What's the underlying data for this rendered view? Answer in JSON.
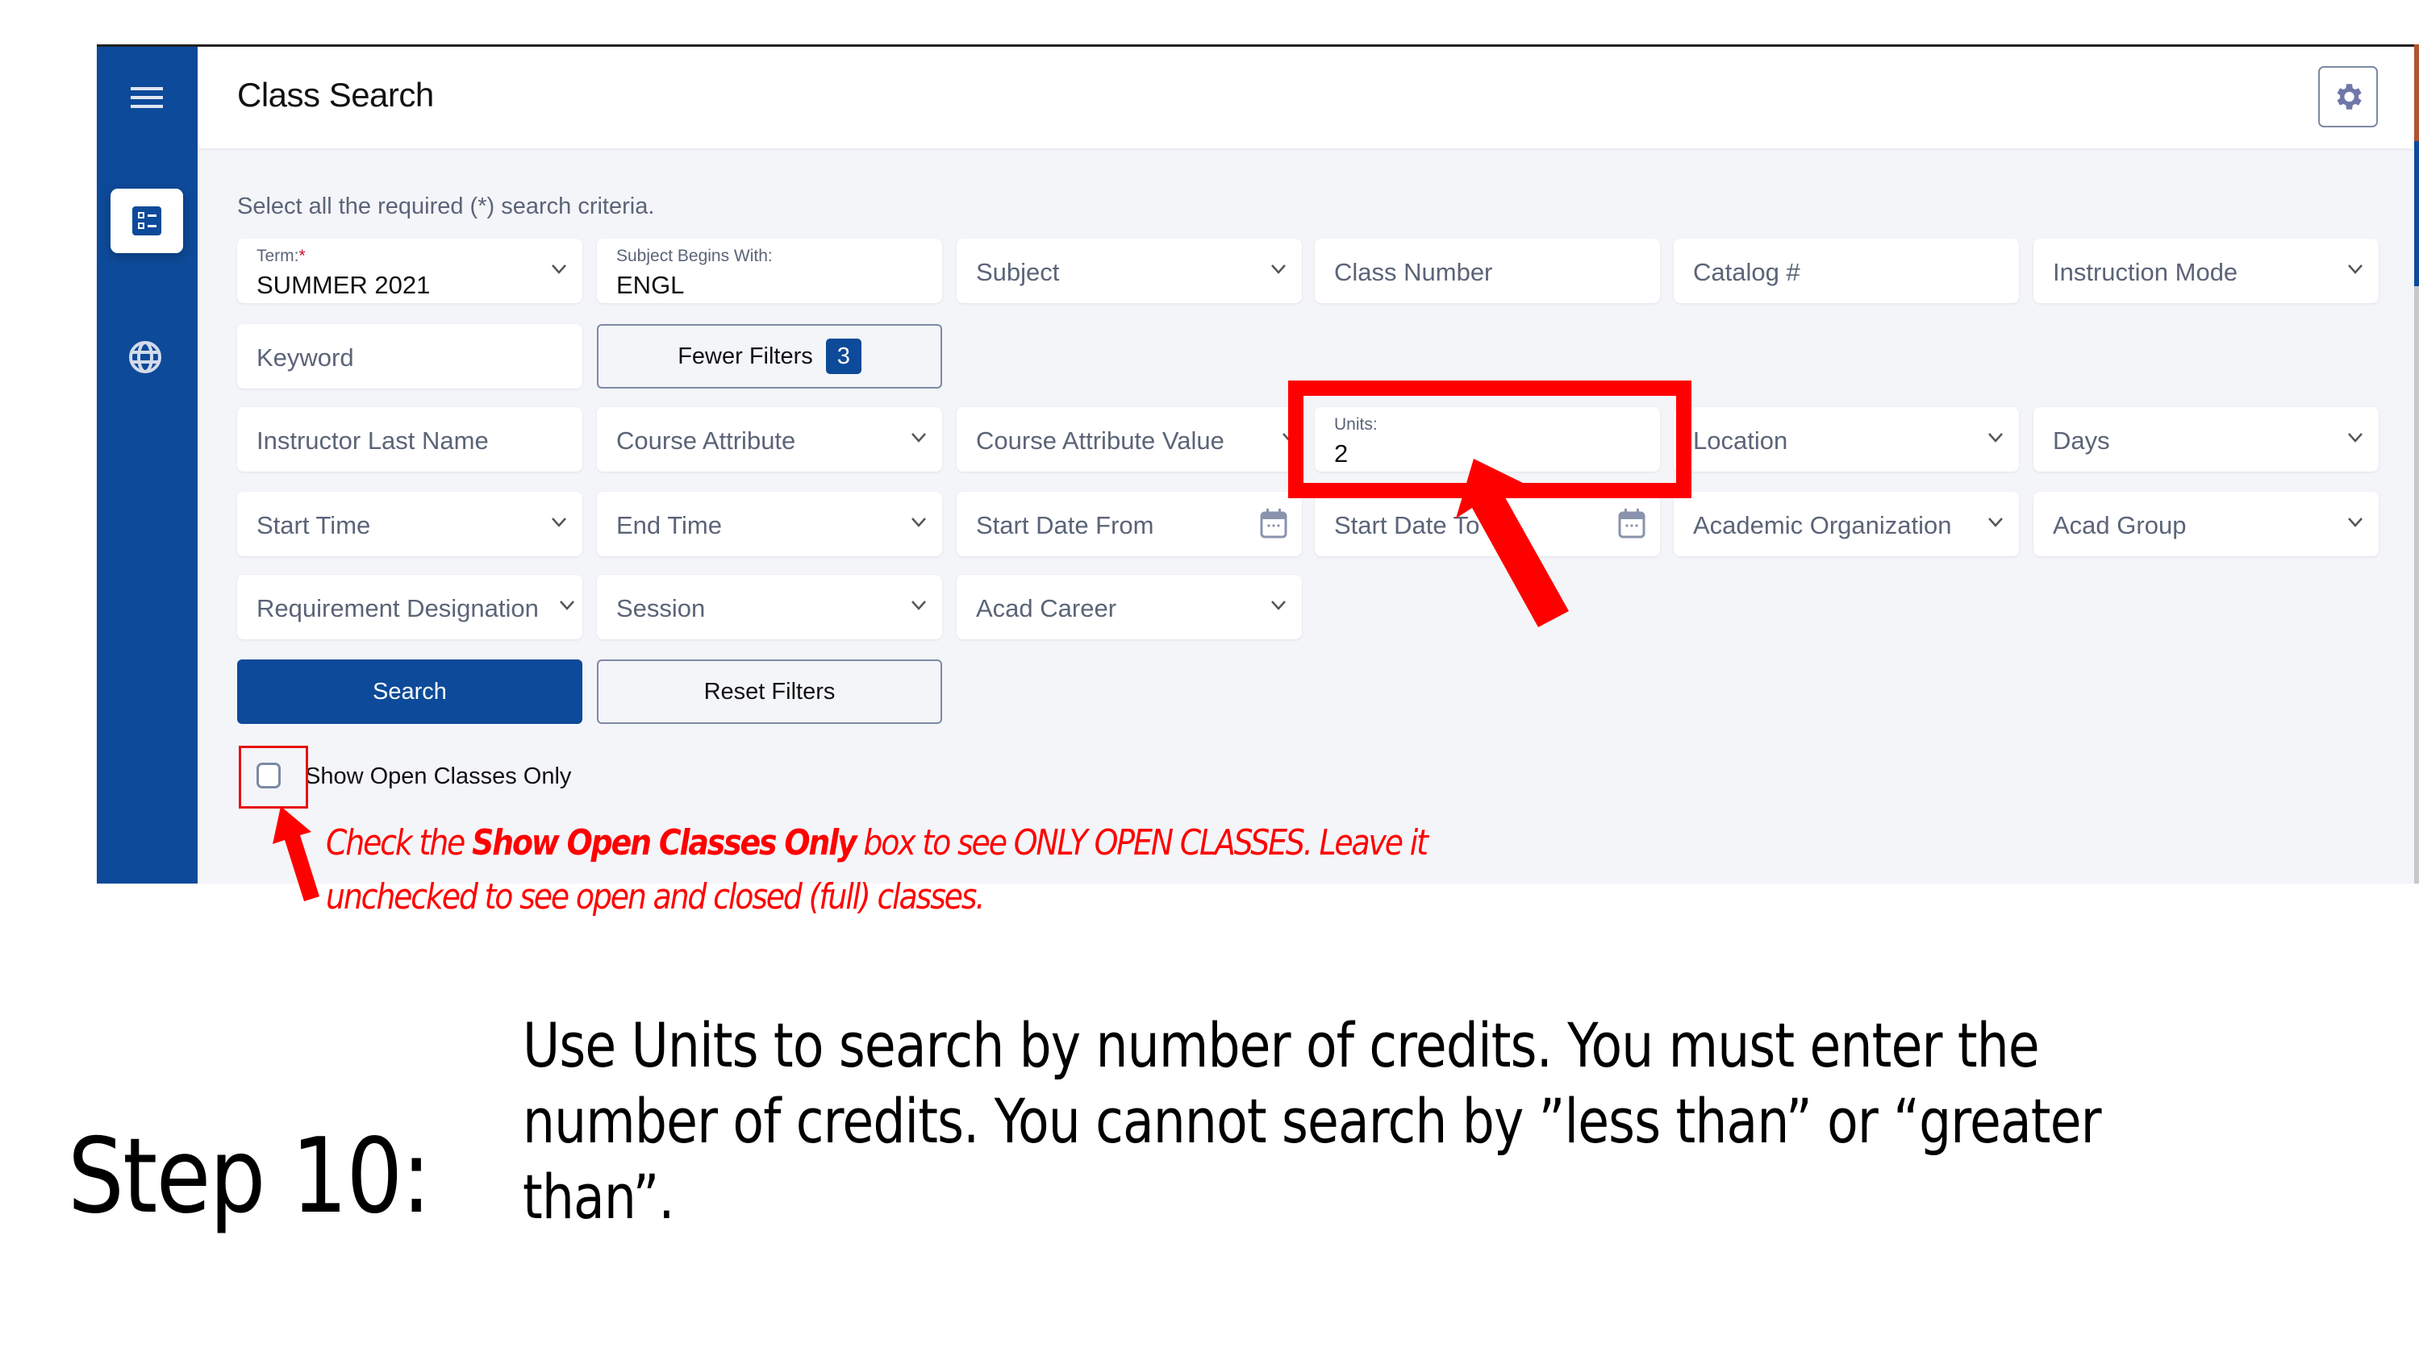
{
  "app": {
    "title": "Class Search"
  },
  "sidebar": {
    "items": [
      {
        "name": "menu",
        "icon": "hamburger-icon"
      },
      {
        "name": "class-search",
        "icon": "checklist-icon",
        "active": true
      },
      {
        "name": "language",
        "icon": "globe-icon"
      }
    ]
  },
  "header": {
    "settings_icon": "gear-icon"
  },
  "form": {
    "instructions": "Select all the required (*) search criteria.",
    "term": {
      "label": "Term:",
      "required_mark": "*",
      "value": "SUMMER 2021"
    },
    "subject_begins": {
      "label": "Subject Begins With:",
      "value": "ENGL"
    },
    "subject": {
      "placeholder": "Subject"
    },
    "class_number": {
      "placeholder": "Class Number"
    },
    "catalog": {
      "placeholder": "Catalog #"
    },
    "instruction_mode": {
      "placeholder": "Instruction Mode"
    },
    "keyword": {
      "placeholder": "Keyword"
    },
    "fewer_filters": {
      "label": "Fewer Filters",
      "count": "3"
    },
    "instructor": {
      "placeholder": "Instructor Last Name"
    },
    "course_attribute": {
      "placeholder": "Course Attribute"
    },
    "course_attribute_value": {
      "placeholder": "Course Attribute Value"
    },
    "units": {
      "label": "Units:",
      "value": "2"
    },
    "location": {
      "placeholder": "Location"
    },
    "days": {
      "placeholder": "Days"
    },
    "start_time": {
      "placeholder": "Start Time"
    },
    "end_time": {
      "placeholder": "End Time"
    },
    "start_date_from": {
      "placeholder": "Start Date From"
    },
    "start_date_to": {
      "placeholder": "Start Date To"
    },
    "academic_org": {
      "placeholder": "Academic Organization"
    },
    "acad_group": {
      "placeholder": "Acad Group"
    },
    "requirement": {
      "placeholder": "Requirement Designation"
    },
    "session": {
      "placeholder": "Session"
    },
    "acad_career": {
      "placeholder": "Acad Career"
    },
    "search_label": "Search",
    "reset_label": "Reset Filters",
    "open_only": {
      "label": "Show Open Classes Only",
      "checked": false
    }
  },
  "annotation": {
    "part1": "Check the ",
    "bold": "Show Open Classes Only",
    "part2": " box to see ONLY OPEN CLASSES. Leave it",
    "line2": "unchecked to see open and closed (full) classes.",
    "color": "#ff0000"
  },
  "caption": {
    "step": "Step 10:",
    "line1_pre": "Use ",
    "line1_term": "Units",
    "line1_post": " to search by number of credits. You must enter the",
    "line2": "number of credits. You cannot search by ”less than” or “greater",
    "line3": "than”."
  },
  "colors": {
    "brand_blue": "#0d4a99",
    "highlight_red": "#ff0000",
    "panel_bg": "#f4f5f9",
    "placeholder_gray": "#5b6478"
  }
}
